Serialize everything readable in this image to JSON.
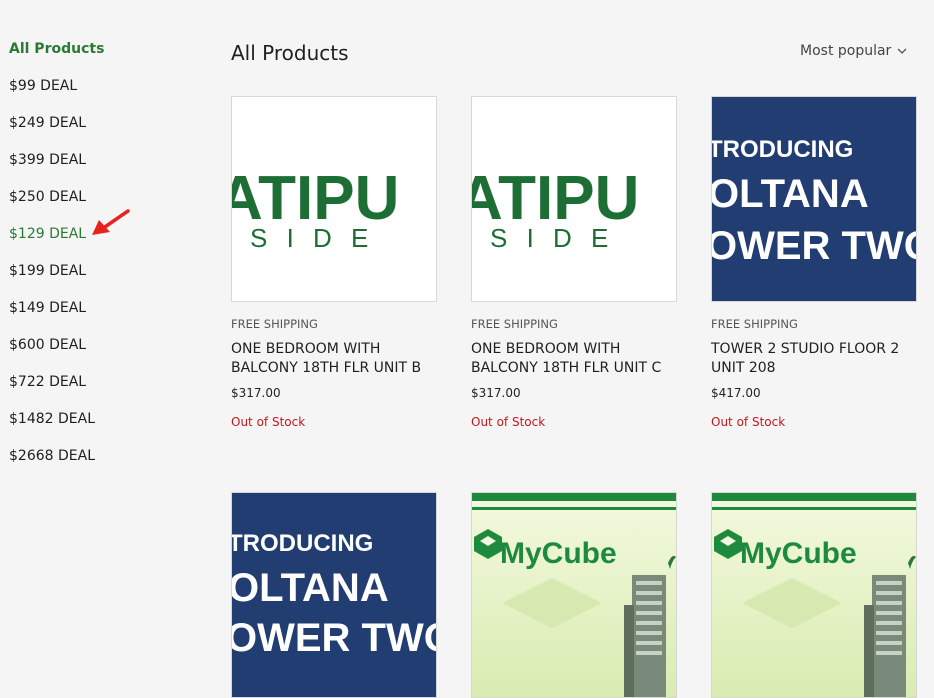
{
  "sidebar": {
    "items": [
      {
        "label": "All Products"
      },
      {
        "label": "$99 DEAL"
      },
      {
        "label": "$249 DEAL"
      },
      {
        "label": "$399 DEAL"
      },
      {
        "label": "$250 DEAL"
      },
      {
        "label": "$129 DEAL"
      },
      {
        "label": "$199 DEAL"
      },
      {
        "label": "$149 DEAL"
      },
      {
        "label": "$600 DEAL"
      },
      {
        "label": "$722 DEAL"
      },
      {
        "label": "$1482 DEAL"
      },
      {
        "label": "$2668 DEAL"
      }
    ],
    "annotation_color": "#e8221e"
  },
  "header": {
    "title": "All Products",
    "sort_label": "Most popular"
  },
  "colors": {
    "brand_green": "#2a7a34",
    "out_of_stock": "#c4161c",
    "poster_blue": "#213d72"
  },
  "products": [
    {
      "shipping": "FREE SHIPPING",
      "name": "ONE BEDROOM WITH BALCONY 18TH FLR UNIT B",
      "price": "$317.00",
      "stock": "Out of Stock",
      "image": {
        "line1": "ATIPU",
        "line2": "S I D E"
      }
    },
    {
      "shipping": "FREE SHIPPING",
      "name": "ONE BEDROOM WITH BALCONY 18TH FLR UNIT C",
      "price": "$317.00",
      "stock": "Out of Stock",
      "image": {
        "line1": "ATIPU",
        "line2": "S I D E"
      }
    },
    {
      "shipping": "FREE SHIPPING",
      "name": "TOWER 2 STUDIO FLOOR 2 UNIT 208",
      "price": "$417.00",
      "stock": "Out of Stock",
      "image": {
        "line1": "TRODUCING",
        "line2": "OLTANA",
        "line3": "OWER TWO"
      }
    },
    {
      "image": {
        "line1": "TRODUCING",
        "line2": "OLTANA",
        "line3": "OWER TWO"
      }
    },
    {
      "image": {
        "line1": "MyCube"
      }
    },
    {
      "image": {
        "line1": "MyCube"
      }
    }
  ]
}
